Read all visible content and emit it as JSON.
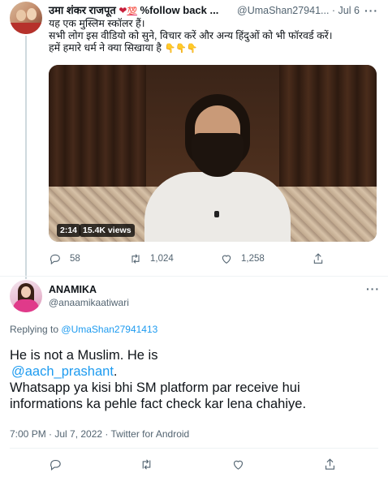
{
  "tweet1": {
    "author_name": "उमा शंकर राजपूत",
    "emoji_heart": "❤",
    "emoji_hundred": "💯",
    "name_suffix": "%follow back ...",
    "handle_time": "@UmaShan27941... · Jul 6",
    "more_label": "···",
    "text_lines": [
      "यह एक मुस्लिम स्कॉलर हैं।",
      "सभी लोग इस वीडियो को सुने, विचार करें और अन्य हिंदुओं को भी फॉरवर्ड करें।",
      "हमें हमारे धर्म ने क्या सिखाया है"
    ],
    "hand_emojis": "👇👇👇",
    "video": {
      "duration": "2:14",
      "views": "15.4K views"
    },
    "actions": {
      "replies": "58",
      "retweets": "1,024",
      "likes": "1,258"
    }
  },
  "tweet2": {
    "author_name": "ANAMIKA",
    "handle": "@anaamikaatiwari",
    "more_label": "···",
    "replying_prefix": "Replying to",
    "replying_to": "@UmaShan27941413",
    "text": {
      "line1": "He is not a Muslim. He is",
      "mention": "@aach_prashant",
      "mention_suffix": ".",
      "line3": "Whatsapp ya kisi bhi SM platform par receive hui",
      "line4": "informations ka pehle fact check kar lena chahiye."
    },
    "meta": "7:00 PM · Jul 7, 2022 · Twitter for Android"
  },
  "icons": {
    "reply": "reply-icon",
    "retweet": "retweet-icon",
    "like": "like-icon",
    "share": "share-icon",
    "more": "more-icon"
  },
  "colors": {
    "link": "#1d9bf0",
    "secondary_text": "#536471",
    "primary_text": "#0f1419",
    "divider": "#eff3f4"
  }
}
